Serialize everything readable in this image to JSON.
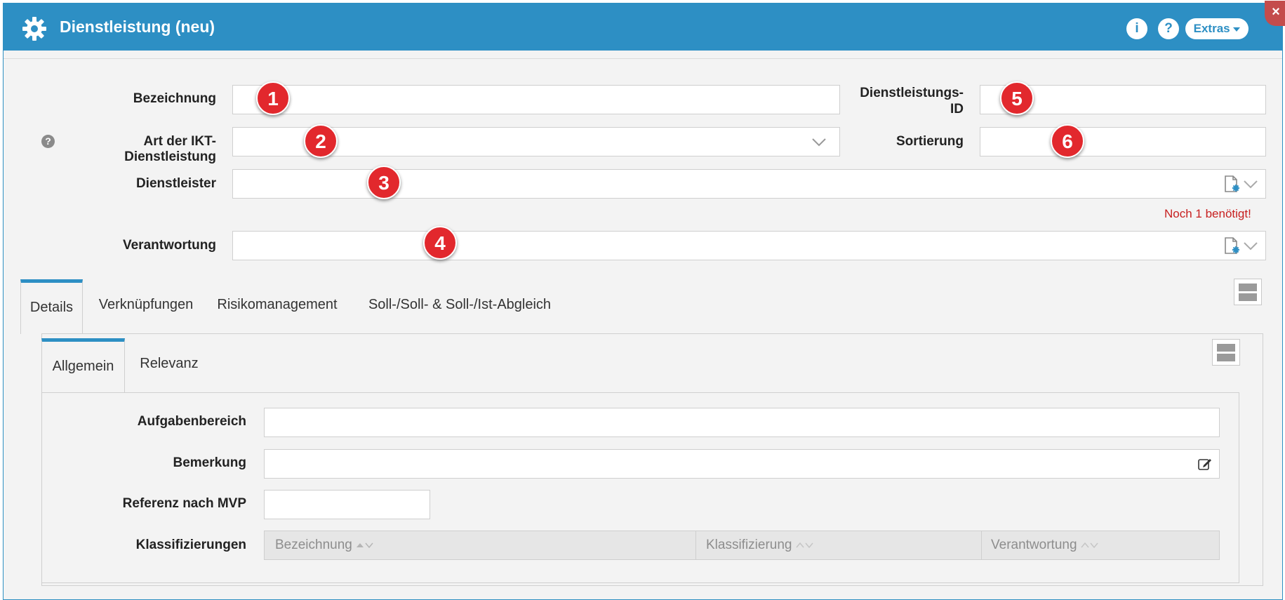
{
  "window": {
    "title": "Dienstleistung (neu)",
    "info_label": "i",
    "help_label": "?",
    "extras_label": "Extras",
    "close_label": "×"
  },
  "form": {
    "bezeichnung_label": "Bezeichnung",
    "art_label": "Art der IKT-Dienstleistung",
    "dienstleister_label": "Dienstleister",
    "verantwortung_label": "Verantwortung",
    "dienstleistungs_id_label_1": "Dienstleistungs-",
    "dienstleistungs_id_label_2": "ID",
    "sortierung_label": "Sortierung",
    "required_hint": "Noch 1 benötigt!"
  },
  "badges": [
    "1",
    "2",
    "3",
    "4",
    "5",
    "6"
  ],
  "main_tabs": [
    "Details",
    "Verknüpfungen",
    "Risikomanagement",
    "Soll-/Soll- & Soll-/Ist-Abgleich"
  ],
  "sub_tabs": [
    "Allgemein",
    "Relevanz"
  ],
  "details": {
    "aufgabenbereich_label": "Aufgabenbereich",
    "bemerkung_label": "Bemerkung",
    "referenz_label": "Referenz nach MVP",
    "klassifizierungen_label": "Klassifizierungen"
  },
  "table": {
    "columns": [
      "Bezeichnung",
      "Klassifizierung",
      "Verantwortung"
    ]
  },
  "colors": {
    "accent": "#2d8fc4",
    "badge": "#e2282d",
    "required": "#c71f1f"
  }
}
